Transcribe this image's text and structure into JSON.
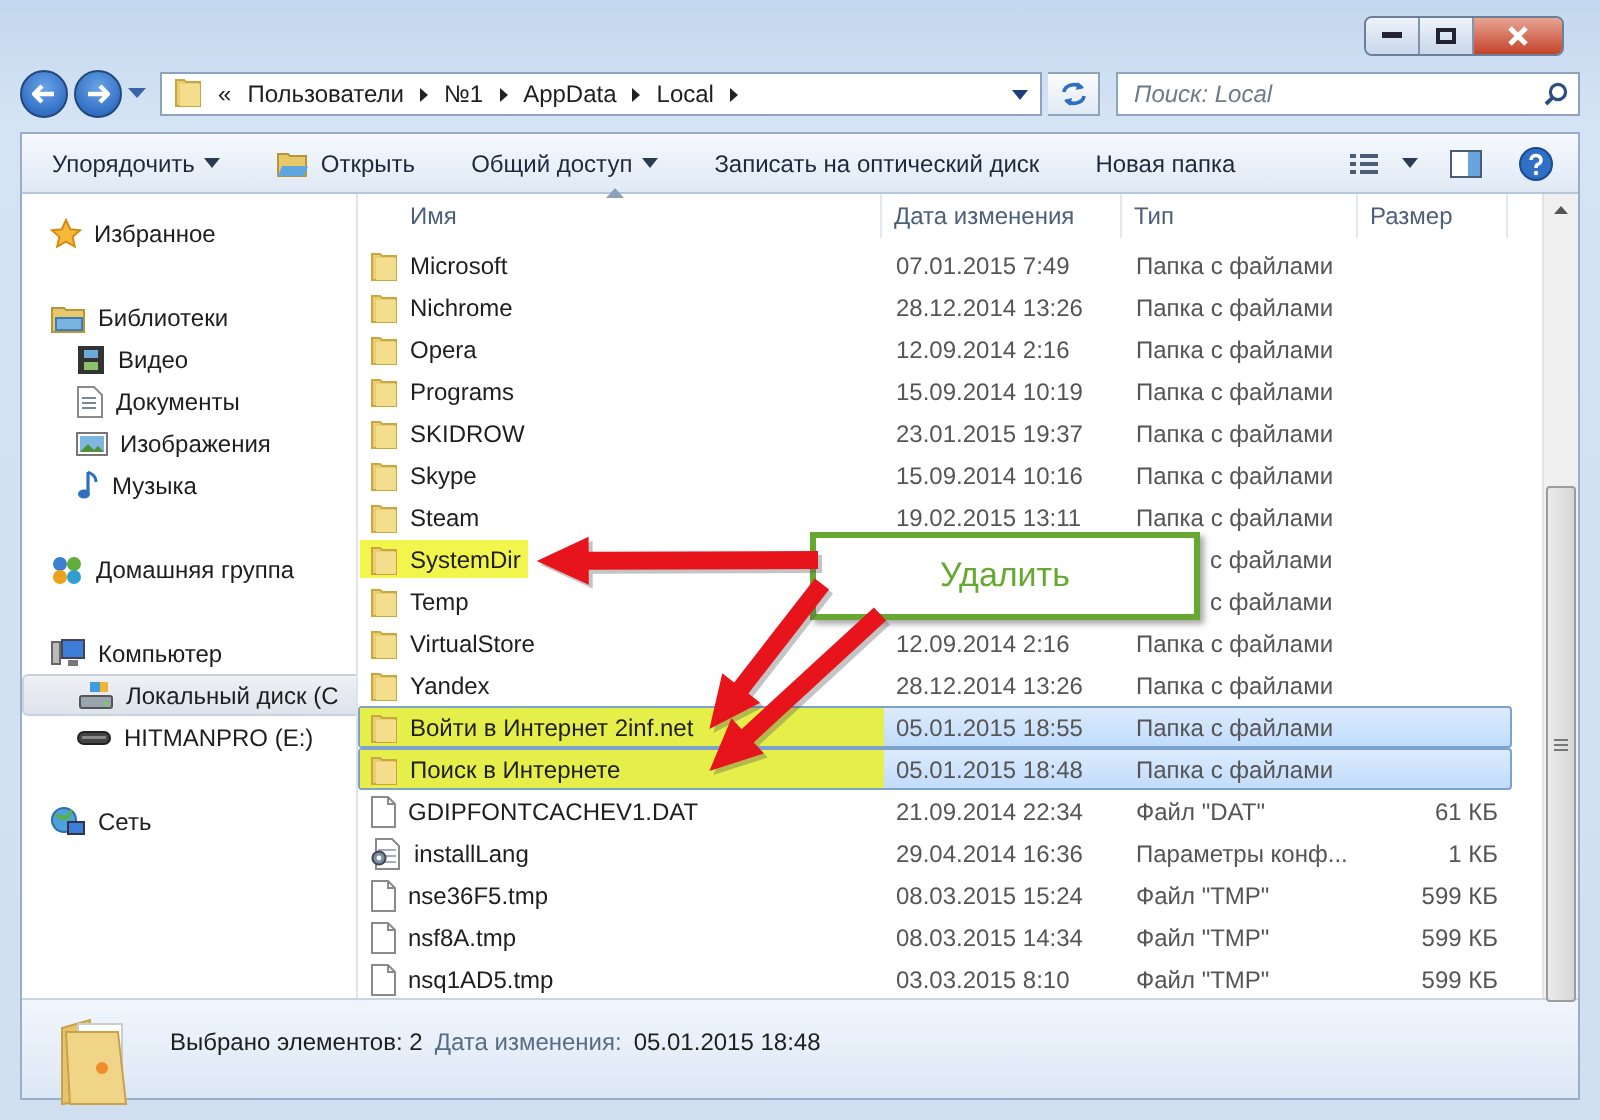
{
  "address_bar": {
    "prefix": "«",
    "path": [
      "Пользователи",
      "№1",
      "AppData",
      "Local"
    ]
  },
  "search": {
    "placeholder": "Поиск: Local"
  },
  "toolbar": [
    {
      "label": "Упорядочить",
      "kind": "menu"
    },
    {
      "label": "Открыть",
      "kind": "open"
    },
    {
      "label": "Общий доступ",
      "kind": "menu"
    },
    {
      "label": "Записать на оптический диск",
      "kind": "plain"
    },
    {
      "label": "Новая папка",
      "kind": "plain"
    }
  ],
  "sidebar": [
    {
      "label": "Избранное",
      "kind": "star",
      "selected": false
    },
    {
      "label": "Библиотеки",
      "kind": "library",
      "selected": false,
      "children": [
        {
          "label": "Видео",
          "kind": "video",
          "selected": false
        },
        {
          "label": "Документы",
          "kind": "document",
          "selected": false
        },
        {
          "label": "Изображения",
          "kind": "image",
          "selected": false
        },
        {
          "label": "Музыка",
          "kind": "music",
          "selected": false
        }
      ]
    },
    {
      "label": "Домашняя группа",
      "kind": "homegroup",
      "selected": false
    },
    {
      "label": "Компьютер",
      "kind": "computer",
      "selected": false,
      "children": [
        {
          "label": "Локальный диск (C",
          "kind": "disk",
          "selected": true
        },
        {
          "label": "HITMANPRO (E:)",
          "kind": "usb",
          "selected": false
        }
      ]
    },
    {
      "label": "Сеть",
      "kind": "network",
      "selected": false
    }
  ],
  "columns": [
    {
      "label": "Имя",
      "sorted": true
    },
    {
      "label": "Дата изменения",
      "sorted": false
    },
    {
      "label": "Тип",
      "sorted": false
    },
    {
      "label": "Размер",
      "sorted": false
    }
  ],
  "rows": [
    {
      "name": "Microsoft",
      "date": "07.01.2015 7:49",
      "type": "Папка с файлами",
      "kind": "folder",
      "selected": false,
      "highlighted": false,
      "covered": false
    },
    {
      "name": "Nichrome",
      "date": "28.12.2014 13:26",
      "type": "Папка с файлами",
      "kind": "folder",
      "selected": false,
      "highlighted": false,
      "covered": false
    },
    {
      "name": "Opera",
      "date": "12.09.2014 2:16",
      "type": "Папка с файлами",
      "kind": "folder",
      "selected": false,
      "highlighted": false,
      "covered": false
    },
    {
      "name": "Programs",
      "date": "15.09.2014 10:19",
      "type": "Папка с файлами",
      "kind": "folder",
      "selected": false,
      "highlighted": false,
      "covered": false
    },
    {
      "name": "SKIDROW",
      "date": "23.01.2015 19:37",
      "type": "Папка с файлами",
      "kind": "folder",
      "selected": false,
      "highlighted": false,
      "covered": false
    },
    {
      "name": "Skype",
      "date": "15.09.2014 10:16",
      "type": "Папка с файлами",
      "kind": "folder",
      "selected": false,
      "highlighted": false,
      "covered": false
    },
    {
      "name": "Steam",
      "date": "19.02.2015 13:11",
      "type": "Папка с файлами",
      "kind": "folder",
      "selected": false,
      "highlighted": false,
      "covered": false
    },
    {
      "name": "SystemDir",
      "type": "с файлами",
      "kind": "folder",
      "selected": false,
      "highlighted": true,
      "covered": true
    },
    {
      "name": "Temp",
      "type": "с файлами",
      "kind": "folder",
      "selected": false,
      "highlighted": false,
      "covered": true
    },
    {
      "name": "VirtualStore",
      "date": "12.09.2014 2:16",
      "type": "Папка с файлами",
      "kind": "folder",
      "selected": false,
      "highlighted": false,
      "covered": false
    },
    {
      "name": "Yandex",
      "date": "28.12.2014 13:26",
      "type": "Папка с файлами",
      "kind": "folder",
      "selected": false,
      "highlighted": false,
      "covered": false
    },
    {
      "name": "Войти в Интернет 2inf.net",
      "date": "05.01.2015 18:55",
      "type": "Папка с файлами",
      "kind": "folder",
      "selected": true,
      "highlighted": true,
      "covered": false
    },
    {
      "name": "Поиск в Интернете",
      "date": "05.01.2015 18:48",
      "type": "Папка с файлами",
      "kind": "folder",
      "selected": true,
      "highlighted": true,
      "covered": false
    },
    {
      "name": "GDIPFONTCACHEV1.DAT",
      "date": "21.09.2014 22:34",
      "type": "Файл \"DAT\"",
      "size": "61 КБ",
      "kind": "file",
      "selected": false,
      "highlighted": false,
      "covered": false
    },
    {
      "name": "installLang",
      "date": "29.04.2014 16:36",
      "type": "Параметры конф...",
      "size": "1 КБ",
      "kind": "config",
      "selected": false,
      "highlighted": false,
      "covered": false
    },
    {
      "name": "nse36F5.tmp",
      "date": "08.03.2015 15:24",
      "type": "Файл \"TMP\"",
      "size": "599 КБ",
      "kind": "file",
      "selected": false,
      "highlighted": false,
      "covered": false
    },
    {
      "name": "nsf8A.tmp",
      "date": "08.03.2015 14:34",
      "type": "Файл \"TMP\"",
      "size": "599 КБ",
      "kind": "file",
      "selected": false,
      "highlighted": false,
      "covered": false
    },
    {
      "name": "nsq1AD5.tmp",
      "date": "03.03.2015 8:10",
      "type": "Файл \"TMP\"",
      "size": "599 КБ",
      "kind": "file",
      "selected": false,
      "highlighted": false,
      "covered": false
    }
  ],
  "callout": {
    "text": "Удалить"
  },
  "status_bar": {
    "selection": "Выбрано элементов: 2",
    "date_label": "Дата изменения:",
    "date": "05.01.2015 18:48"
  }
}
